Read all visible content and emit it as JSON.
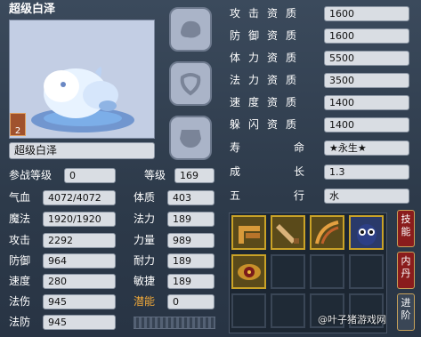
{
  "pet": {
    "title": "超级白泽",
    "name": "超级白泽",
    "grade_badge": "2"
  },
  "battle_level": {
    "label": "参战等级",
    "value": "0"
  },
  "level": {
    "label": "等级",
    "value": "169"
  },
  "stats_left": [
    {
      "label": "气血",
      "value": "4072/4072"
    },
    {
      "label": "魔法",
      "value": "1920/1920"
    },
    {
      "label": "攻击",
      "value": "2292"
    },
    {
      "label": "防御",
      "value": "964"
    },
    {
      "label": "速度",
      "value": "280"
    },
    {
      "label": "法伤",
      "value": "945"
    },
    {
      "label": "法防",
      "value": "945"
    }
  ],
  "stats_mid": [
    {
      "label": "体质",
      "value": "403"
    },
    {
      "label": "法力",
      "value": "189"
    },
    {
      "label": "力量",
      "value": "989"
    },
    {
      "label": "耐力",
      "value": "189"
    },
    {
      "label": "敏捷",
      "value": "189"
    },
    {
      "label": "潜能",
      "value": "0"
    }
  ],
  "aptitudes": [
    {
      "label": "攻击资质",
      "value": "1600"
    },
    {
      "label": "防御资质",
      "value": "1600"
    },
    {
      "label": "体力资质",
      "value": "5500"
    },
    {
      "label": "法力资质",
      "value": "3500"
    },
    {
      "label": "速度资质",
      "value": "1400"
    },
    {
      "label": "躲闪资质",
      "value": "1400"
    }
  ],
  "lifespan": {
    "label_a": "寿",
    "label_b": "命",
    "value": "★永生★"
  },
  "growth": {
    "label_a": "成",
    "label_b": "长",
    "value": "1.3"
  },
  "element": {
    "label_a": "五",
    "label_b": "行",
    "value": "水"
  },
  "equip_slots": [
    "helmet-slot-icon",
    "collar-slot-icon",
    "armor-slot-icon"
  ],
  "skills": [
    "skill-feather-icon",
    "skill-sword-icon",
    "skill-slash-icon",
    "skill-owl-icon",
    "skill-eye-icon"
  ],
  "side_buttons": {
    "skills": "技能",
    "neidan": "内丹",
    "advance": "进阶"
  },
  "watermark": "@叶子猪游戏网",
  "colors": {
    "accent_gold": "#f0a93a",
    "side_red": "#8a1c1c"
  }
}
